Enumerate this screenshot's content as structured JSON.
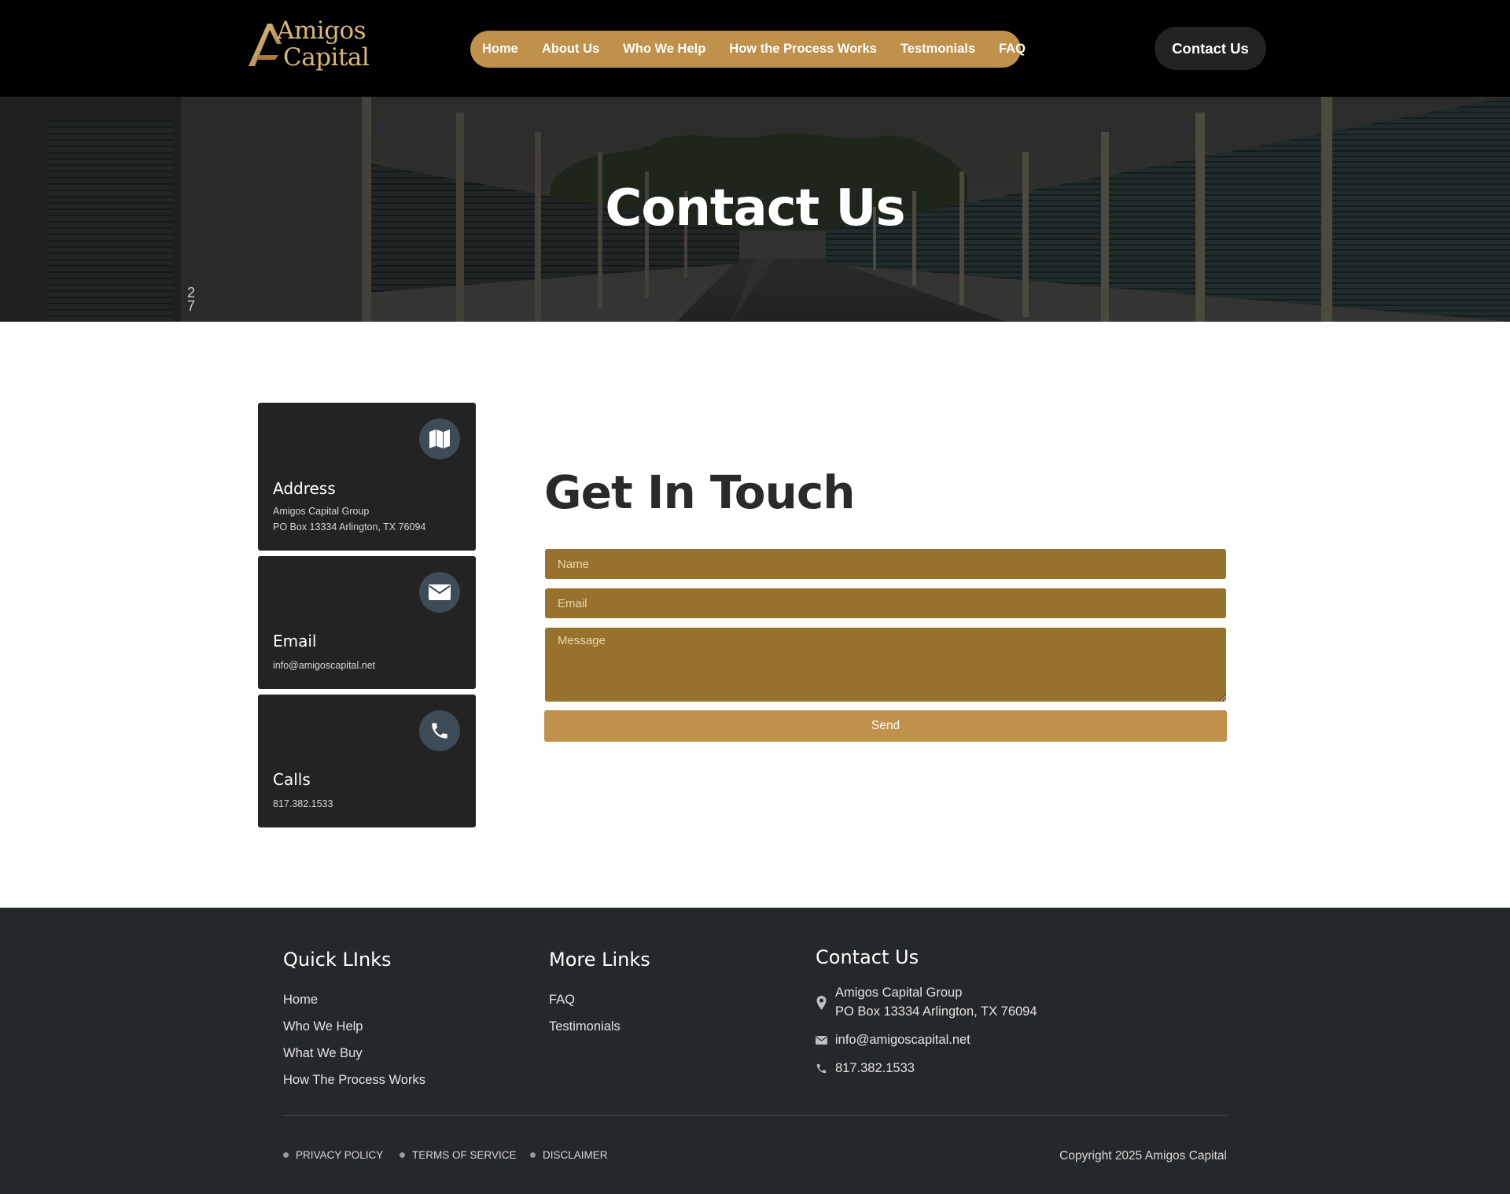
{
  "brand": {
    "logo_line1": "Amigos",
    "logo_line2": "Capital",
    "colors": {
      "gold": "#c0914a",
      "field_gold": "#98712d",
      "dark": "#232323",
      "footer_bg": "#24282a",
      "icon_circle": "#3d4c56"
    }
  },
  "nav": {
    "items": [
      {
        "label": "Home"
      },
      {
        "label": "About Us"
      },
      {
        "label": "Who We Help"
      },
      {
        "label": "How the Process Works"
      },
      {
        "label": "Testmonials"
      },
      {
        "label": "FAQ"
      }
    ],
    "cta_label": "Contact Us"
  },
  "hero": {
    "title": "Contact Us",
    "sign_digits": [
      "2",
      "7"
    ]
  },
  "info_cards": [
    {
      "title": "Address",
      "lines": [
        "Amigos Capital Group",
        "PO Box 13334 Arlington, TX 76094"
      ],
      "icon": "map-icon"
    },
    {
      "title": "Email",
      "lines": [
        "info@amigoscapital.net"
      ],
      "icon": "envelope-icon"
    },
    {
      "title": "Calls",
      "lines": [
        "817.382.1533"
      ],
      "icon": "phone-icon"
    }
  ],
  "form": {
    "title": "Get In Touch",
    "name_placeholder": "Name",
    "email_placeholder": "Email",
    "message_placeholder": "Message",
    "send_label": "Send"
  },
  "footer": {
    "quick_links": {
      "title": "Quick LInks",
      "items": [
        "Home",
        "Who We Help",
        "What We Buy",
        "How The Process Works"
      ]
    },
    "more_links": {
      "title": "More Links",
      "items": [
        "FAQ",
        "Testimonials"
      ]
    },
    "contact": {
      "title": "Contact Us",
      "address_line1": "Amigos Capital Group",
      "address_line2": "PO Box 13334 Arlington, TX 76094",
      "email": "info@amigoscapital.net",
      "phone": "817.382.1533"
    },
    "legal": [
      "PRIVACY POLICY",
      "TERMS OF SERVICE",
      "DISCLAIMER"
    ],
    "copyright": "Copyright 2025 Amigos Capital"
  }
}
